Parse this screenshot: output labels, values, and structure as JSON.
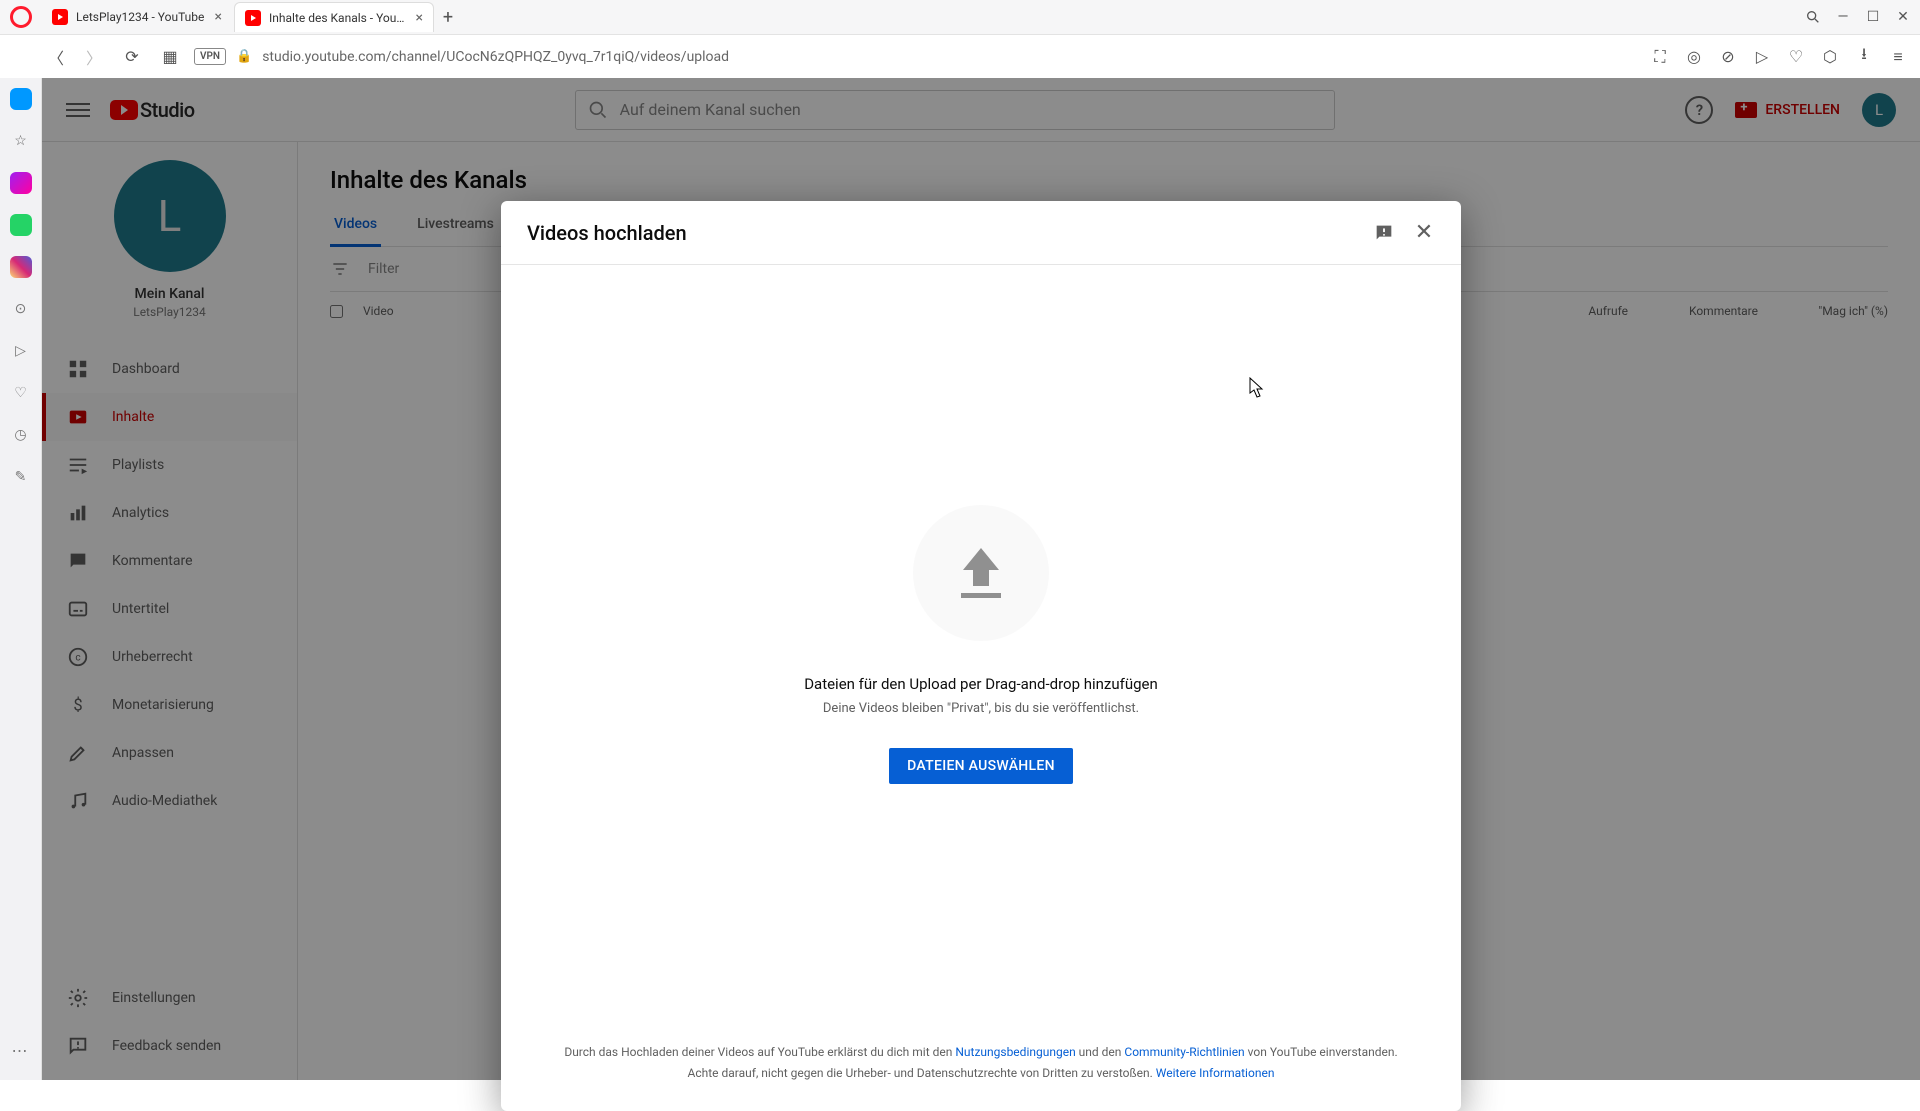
{
  "browser": {
    "tabs": [
      {
        "title": "LetsPlay1234 - YouTube"
      },
      {
        "title": "Inhalte des Kanals - YouTu"
      }
    ],
    "url": "studio.youtube.com/channel/UCocN6zQPHQZ_0yvq_7r1qiQ/videos/upload",
    "vpn": "VPN"
  },
  "header": {
    "logo_text": "Studio",
    "search_placeholder": "Auf deinem Kanal suchen",
    "create_label": "ERSTELLEN",
    "avatar_initial": "L"
  },
  "channel": {
    "avatar_initial": "L",
    "name": "Mein Kanal",
    "handle": "LetsPlay1234"
  },
  "nav": {
    "dashboard": "Dashboard",
    "content": "Inhalte",
    "playlists": "Playlists",
    "analytics": "Analytics",
    "comments": "Kommentare",
    "subtitles": "Untertitel",
    "copyright": "Urheberrecht",
    "monetization": "Monetarisierung",
    "customize": "Anpassen",
    "audio": "Audio-Mediathek",
    "settings": "Einstellungen",
    "feedback": "Feedback senden"
  },
  "main": {
    "title": "Inhalte des Kanals",
    "tab_videos": "Videos",
    "tab_live": "Livestreams",
    "filter_placeholder": "Filter",
    "col_video": "Video",
    "col_views": "Aufrufe",
    "col_comments": "Kommentare",
    "col_likes": "\"Mag ich\" (%)"
  },
  "modal": {
    "title": "Videos hochladen",
    "drop_text": "Dateien für den Upload per Drag-and-drop hinzufügen",
    "drop_sub": "Deine Videos bleiben \"Privat\", bis du sie veröffentlichst.",
    "select_button": "DATEIEN AUSWÄHLEN",
    "footer_1a": "Durch das Hochladen deiner Videos auf YouTube erklärst du dich mit den ",
    "footer_tos": "Nutzungsbedingungen",
    "footer_1b": " und den ",
    "footer_cg": "Community-Richtlinien",
    "footer_1c": " von YouTube einverstanden.",
    "footer_2a": "Achte darauf, nicht gegen die Urheber- und Datenschutzrechte von Dritten zu verstoßen. ",
    "footer_more": "Weitere Informationen"
  }
}
